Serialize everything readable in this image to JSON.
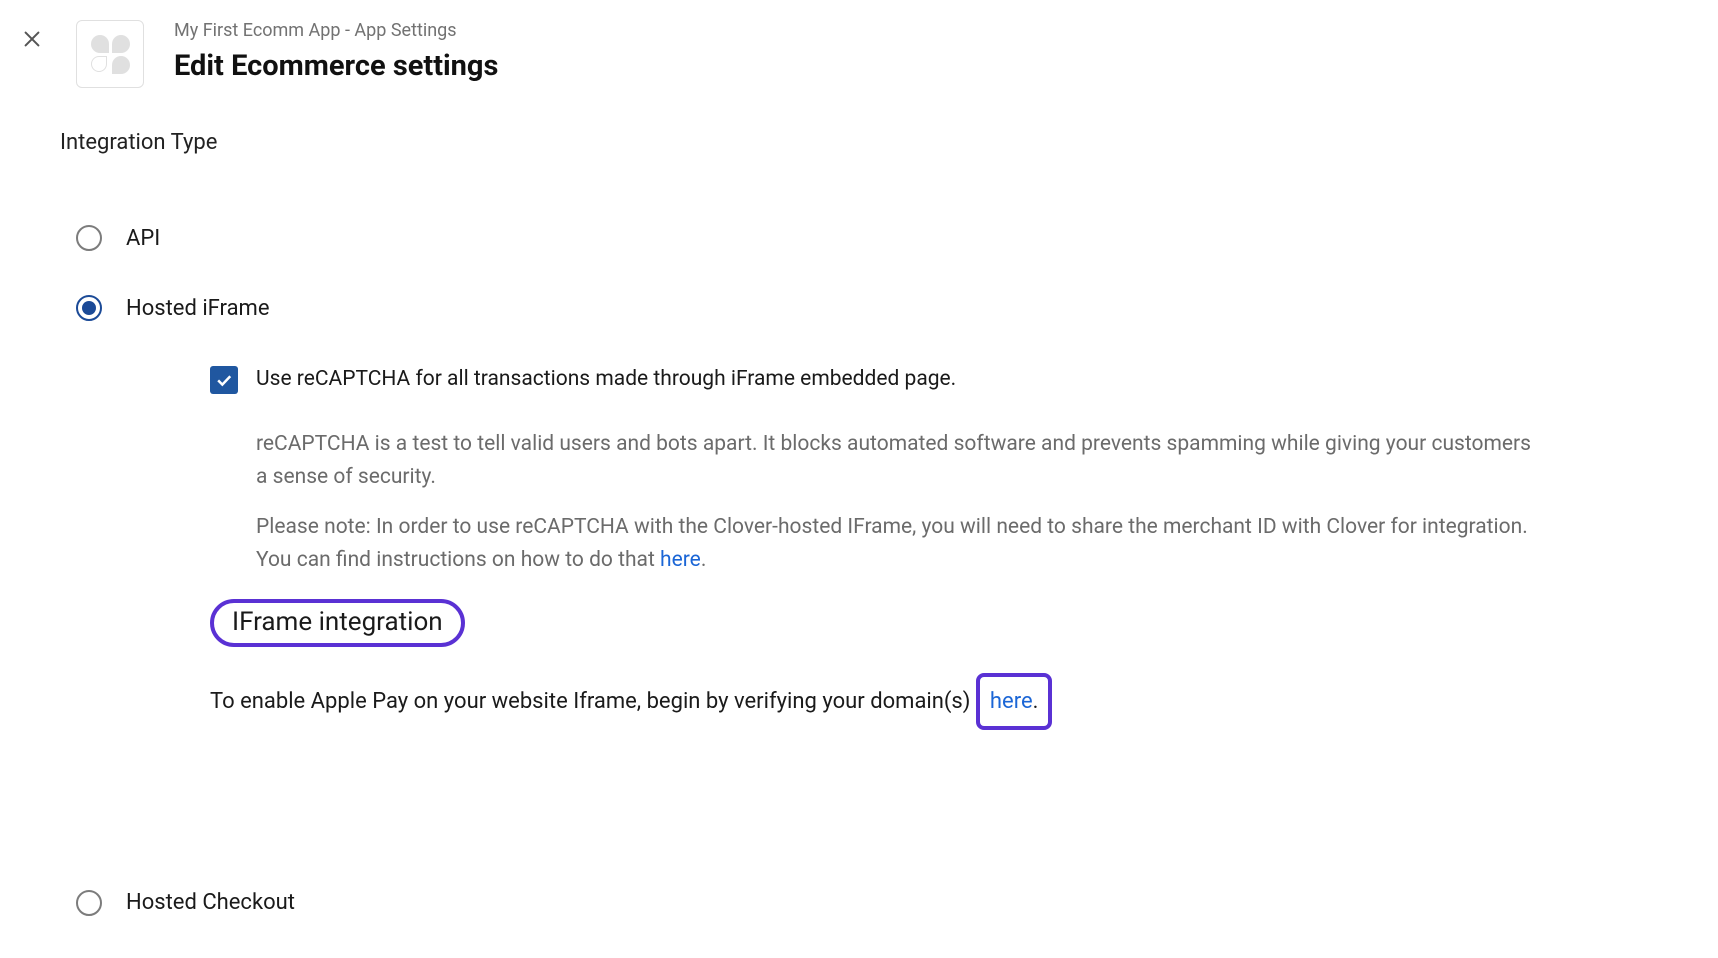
{
  "header": {
    "breadcrumb": "My First Ecomm App - App Settings",
    "title": "Edit Ecommerce settings"
  },
  "section": {
    "heading": "Integration Type"
  },
  "radio": {
    "api_label": "API",
    "hosted_iframe_label": "Hosted iFrame",
    "hosted_checkout_label": "Hosted Checkout"
  },
  "hosted_iframe_detail": {
    "recaptcha_checkbox_label": "Use reCAPTCHA for all transactions made through iFrame embedded page.",
    "recaptcha_desc": "reCAPTCHA is a test to tell valid users and bots apart. It blocks automated software and prevents spamming while giving your customers a sense of security.",
    "recaptcha_note_prefix": "Please note: In order to use reCAPTCHA with the Clover-hosted IFrame, you will need to share the merchant ID with Clover for integration. You can find instructions on how to do that ",
    "recaptcha_note_link": "here",
    "recaptcha_note_suffix": ".",
    "sub_heading": "IFrame integration",
    "apple_pay_prefix": "To enable Apple Pay on your website Iframe, begin by verifying your domain(s) ",
    "apple_pay_link": "here",
    "apple_pay_suffix": "."
  },
  "icons": {
    "close": "close"
  }
}
